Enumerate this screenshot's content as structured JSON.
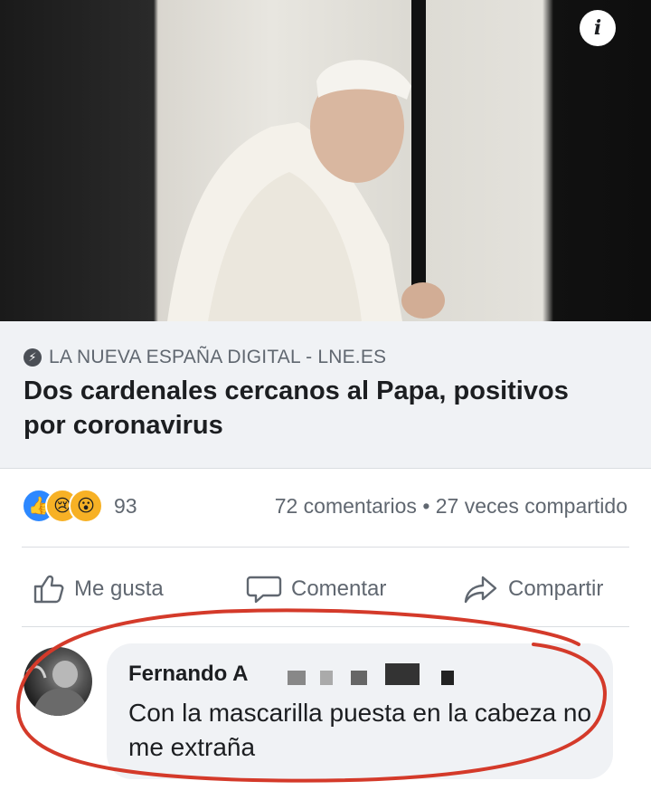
{
  "post": {
    "image": {
      "description": "hero photo",
      "info_icon": "info-icon"
    },
    "link": {
      "source_icon": "lightning-bolt-icon",
      "source": "LA NUEVA ESPAÑA DIGITAL - LNE.ES",
      "headline": "Dos cardenales cercanos al Papa, positivos por coronavirus"
    },
    "stats": {
      "reaction_icons": [
        "like-icon",
        "sad-icon",
        "wow-icon"
      ],
      "reaction_count": "93",
      "comments_shares": "72 comentarios • 27 veces compartido"
    },
    "actions": {
      "like_label": "Me gusta",
      "comment_label": "Comentar",
      "share_label": "Compartir"
    }
  },
  "comment": {
    "author": "Fernando A",
    "text": "Con la mascarilla puesta en la cabeza no me extraña"
  },
  "colors": {
    "annotation_circle": "#d43a2a",
    "link_card_bg": "#f0f2f5",
    "secondary_text": "#606770",
    "like_blue": "#2d88ff"
  }
}
